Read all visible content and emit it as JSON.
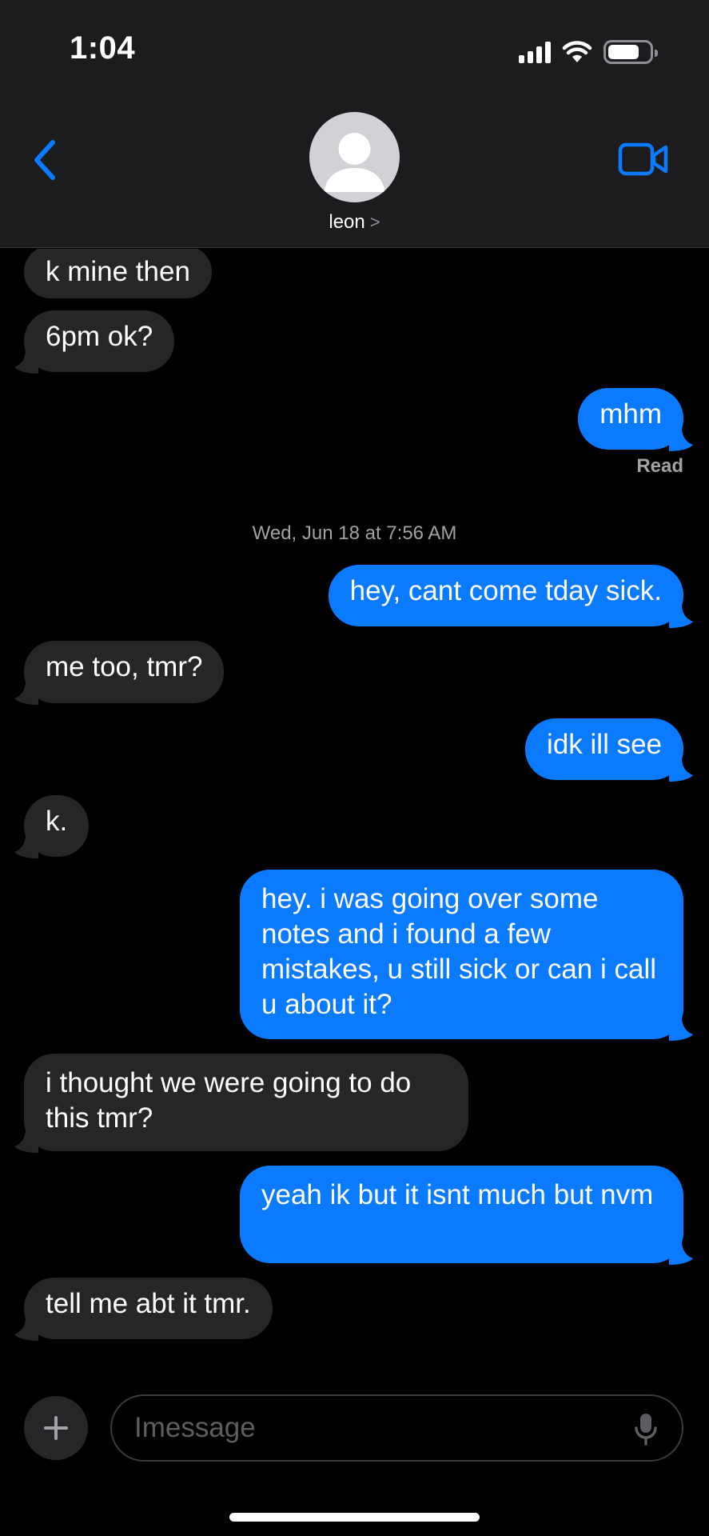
{
  "status_bar": {
    "time": "1:04"
  },
  "header": {
    "contact_name": "leon",
    "contact_chevron": ">"
  },
  "thread": {
    "messages": [
      {
        "from": "them",
        "text": "k mine then"
      },
      {
        "from": "them",
        "text": "6pm ok?"
      },
      {
        "from": "me",
        "text": "mhm"
      },
      {
        "from": "me",
        "text": "hey, cant come tday sick."
      },
      {
        "from": "them",
        "text": "me too, tmr?"
      },
      {
        "from": "me",
        "text": "idk ill see"
      },
      {
        "from": "them",
        "text": "k."
      },
      {
        "from": "me",
        "text": "hey. i was going over some notes and i found a few mistakes, u still sick or can i call u about it?"
      },
      {
        "from": "them",
        "text": "i thought we were going to do this tmr?"
      },
      {
        "from": "me",
        "text": "yeah ik but it isnt much but nvm"
      },
      {
        "from": "them",
        "text": "tell me abt it tmr."
      }
    ],
    "read_receipt": "Read",
    "timestamp": "Wed, Jun 18 at 7:56 AM"
  },
  "composer": {
    "placeholder": "Imessage"
  },
  "colors": {
    "accent": "#0a7aff",
    "incoming_bubble": "#262628",
    "header_bg": "#1c1c1e",
    "background": "#000000"
  },
  "icons": {
    "back": "chevron-left-icon",
    "video": "video-camera-icon",
    "plus": "plus-icon",
    "mic": "microphone-icon",
    "avatar": "person-silhouette-icon",
    "signal": "cellular-signal-icon",
    "wifi": "wifi-icon",
    "battery": "battery-icon"
  }
}
